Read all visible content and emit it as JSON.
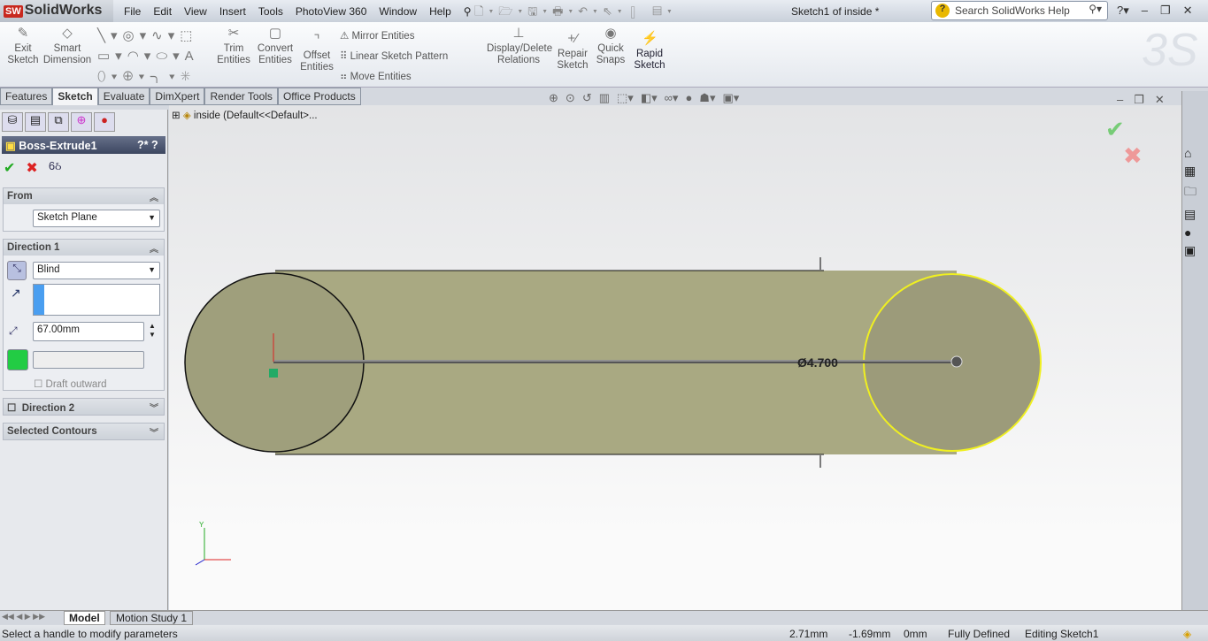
{
  "app": {
    "name": "SolidWorks",
    "logo_text": "SW"
  },
  "menu": [
    "File",
    "Edit",
    "View",
    "Insert",
    "Tools",
    "PhotoView 360",
    "Window",
    "Help"
  ],
  "document_title": "Sketch1 of inside *",
  "search": {
    "placeholder": "Search SolidWorks Help"
  },
  "ribbon": {
    "exit_sketch": "Exit Sketch",
    "smart_dimension": "Smart Dimension",
    "trim_entities": "Trim Entities",
    "convert_entities": "Convert Entities",
    "offset_entities": "Offset Entities",
    "mirror_entities": "Mirror Entities",
    "linear_sketch_pattern": "Linear Sketch Pattern",
    "move_entities": "Move Entities",
    "display_delete_relations": "Display/Delete Relations",
    "repair_sketch": "Repair Sketch",
    "quick_snaps": "Quick Snaps",
    "rapid_sketch": "Rapid Sketch"
  },
  "tabs": [
    {
      "label": "Features"
    },
    {
      "label": "Sketch",
      "active": true
    },
    {
      "label": "Evaluate"
    },
    {
      "label": "DimXpert"
    },
    {
      "label": "Render Tools"
    },
    {
      "label": "Office Products"
    }
  ],
  "tree": {
    "root": "inside  (Default<<Default>..."
  },
  "property_manager": {
    "title": "Boss-Extrude1",
    "from": {
      "header": "From",
      "value": "Sketch Plane"
    },
    "direction1": {
      "header": "Direction 1",
      "end_condition": "Blind",
      "depth": "67.00mm",
      "draft_outward": "Draft outward"
    },
    "direction2": {
      "header": "Direction 2"
    },
    "selected_contours": {
      "header": "Selected Contours"
    }
  },
  "viewport": {
    "dimension_label": "Ø4.700",
    "body_color": "#a9a982",
    "selected_color": "#f0f020"
  },
  "bottom_tabs": [
    "Model",
    "Motion Study 1"
  ],
  "status": {
    "message": "Select a handle to modify parameters",
    "x": "2.71mm",
    "y": "-1.69mm",
    "z": "0mm",
    "state": "Fully Defined",
    "mode": "Editing Sketch1"
  }
}
